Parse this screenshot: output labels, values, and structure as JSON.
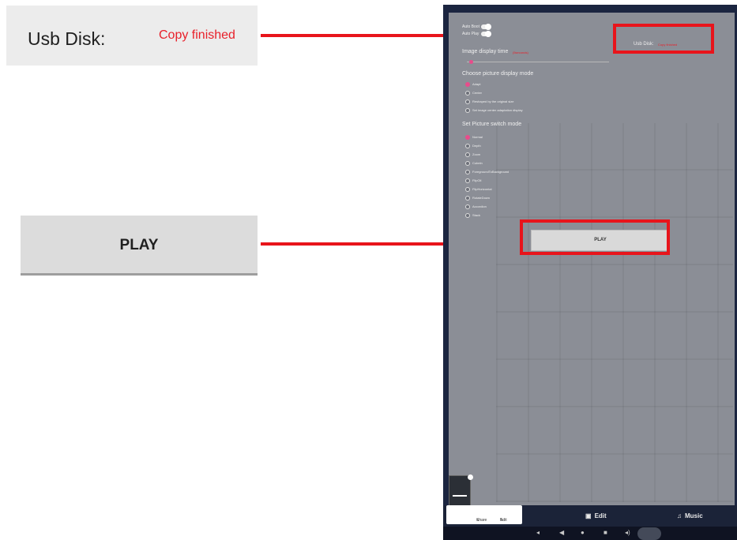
{
  "callouts": {
    "usb_label": "Usb Disk:",
    "usb_status": "Copy finished",
    "play_label": "PLAY"
  },
  "device": {
    "auto_boot_label": "Auto Boot",
    "auto_play_label": "Auto Play",
    "image_display_time_label": "Image display time",
    "image_display_time_value": "(5seconds)",
    "usb_label": "Usb Disk:",
    "usb_status": "Copy finished",
    "display_mode_title": "Choose picture display mode",
    "display_modes": [
      {
        "label": "Adapt",
        "selected": true
      },
      {
        "label": "Center",
        "selected": false
      },
      {
        "label": "Reshaped by the original size",
        "selected": false
      },
      {
        "label": "Set image center adaptation display",
        "selected": false
      }
    ],
    "switch_mode_title": "Set Picture switch mode",
    "switch_modes": [
      {
        "label": "Normal",
        "selected": true
      },
      {
        "label": "Depth",
        "selected": false
      },
      {
        "label": "Zoom",
        "selected": false
      },
      {
        "label": "Cubeln",
        "selected": false
      },
      {
        "label": "ForegroundToBackground",
        "selected": false
      },
      {
        "label": "FlipOll",
        "selected": false
      },
      {
        "label": "FlipHorizontal",
        "selected": false
      },
      {
        "label": "RotateDown",
        "selected": false
      },
      {
        "label": "Accordion",
        "selected": false
      },
      {
        "label": "Stack",
        "selected": false
      }
    ],
    "play_button": "PLAY",
    "bottom_bar": {
      "edit_label": "Edit",
      "music_label": "Music",
      "popup_share": "Share",
      "popup_edit": "Edit"
    },
    "nav_icons": [
      "volume-down-icon",
      "back-icon",
      "home-icon",
      "recents-icon",
      "volume-up-icon",
      "camera-icon"
    ]
  },
  "colors": {
    "highlight": "#e8141b",
    "status_red": "#e8202a",
    "radio_selected": "#e84c8b"
  }
}
